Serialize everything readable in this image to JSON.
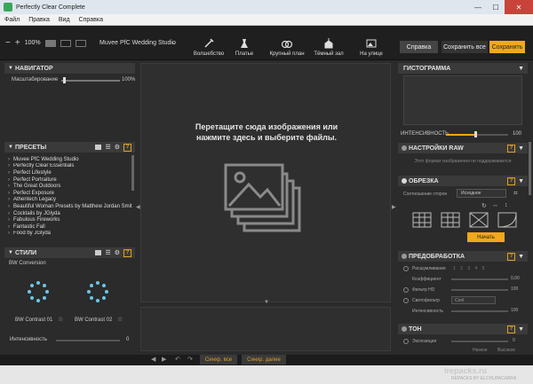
{
  "window": {
    "title": "Perfectly Clear Complete",
    "min_icon": "minimize-icon",
    "max_icon": "maximize-icon",
    "close_icon": "close-icon"
  },
  "menu": [
    "Файл",
    "Правка",
    "Вид",
    "Справка"
  ],
  "toolbar": {
    "zoom_minus": "−",
    "zoom_plus": "+",
    "zoom_value": "100%",
    "preset_name": "Muvee PfC Wedding Studio",
    "quick_presets": [
      {
        "label": "Волшебство",
        "icon": "magic-icon"
      },
      {
        "label": "Платье",
        "icon": "dress-icon"
      },
      {
        "label": "Крупный план",
        "icon": "rings-icon"
      },
      {
        "label": "Тёмный зал",
        "icon": "church-icon"
      },
      {
        "label": "На улице",
        "icon": "landscape-icon"
      }
    ],
    "help_label": "Справка",
    "save_all_label": "Сохранить все",
    "save_label": "Сохранить"
  },
  "navigator": {
    "title": "НАВИГАТОР",
    "scale_label": "Масштабирование",
    "scale_value": "100%"
  },
  "presets": {
    "title": "ПРЕСЕТЫ",
    "items": [
      "Muvee PfC Wedding Studio",
      "Perfectly Clear Essentials",
      "Perfect Lifestyle",
      "Perfect Portraiture",
      "The Great Outdoors",
      "Perfect Exposure",
      "Athentech Legacy",
      "Beautiful Woman Presets by Matthew Jordan Smith",
      "Cocktails by JGlyda",
      "Fabulous Fireworks",
      "Fantastic Fall",
      "Food by JGlyda"
    ]
  },
  "styles": {
    "title": "СТИЛИ",
    "group": "BW Conversion",
    "items": [
      "BW Contrast 01",
      "BW Contrast 02"
    ],
    "intensity_label": "Интенсивность",
    "intensity_value": "0"
  },
  "canvas": {
    "drop_text_line1": "Перетащите сюда изображения или",
    "drop_text_line2": "нажмите здесь и выберите файлы."
  },
  "right": {
    "histogram_title": "ГИСТОГРАММА",
    "intensity_label": "ИНТЕНСИВНОСТЬ",
    "intensity_value": "100",
    "raw_title": "НАСТРОЙКИ RAW",
    "raw_note": "Этот формат изображения не поддерживается",
    "crop_title": "ОБРЕЗКА",
    "crop_ratio_label": "Соотношение сторон",
    "crop_ratio_value": "Исходное",
    "crop_start": "Начать",
    "pre_title": "ПРЕДОБРАБОТКА",
    "pre_rows": [
      {
        "label": "Расшумливание",
        "value": "1 2 3 4 5"
      },
      {
        "label": "Коэффициент",
        "value": "0,00"
      },
      {
        "label": "Фильтр HD",
        "value": "100"
      },
      {
        "label": "Светофильтр",
        "value": "Cool"
      },
      {
        "label": "Интенсивность",
        "value": "100"
      }
    ],
    "tone_title": "ТОН",
    "tone_row_label": "Экспозиция",
    "tone_row_value": "0",
    "tone_options": [
      "Низкое",
      "Высокое"
    ]
  },
  "bottom": {
    "sync_all": "Синхр. все",
    "sync_next": "Синхр. далее"
  },
  "watermark": {
    "site": "Irepacks.ru",
    "note": "REPACKS BY ELCHUPACABRA"
  },
  "colors": {
    "accent": "#f0a81c",
    "panel": "#3a3a3a",
    "bg": "#2b2b2b"
  }
}
